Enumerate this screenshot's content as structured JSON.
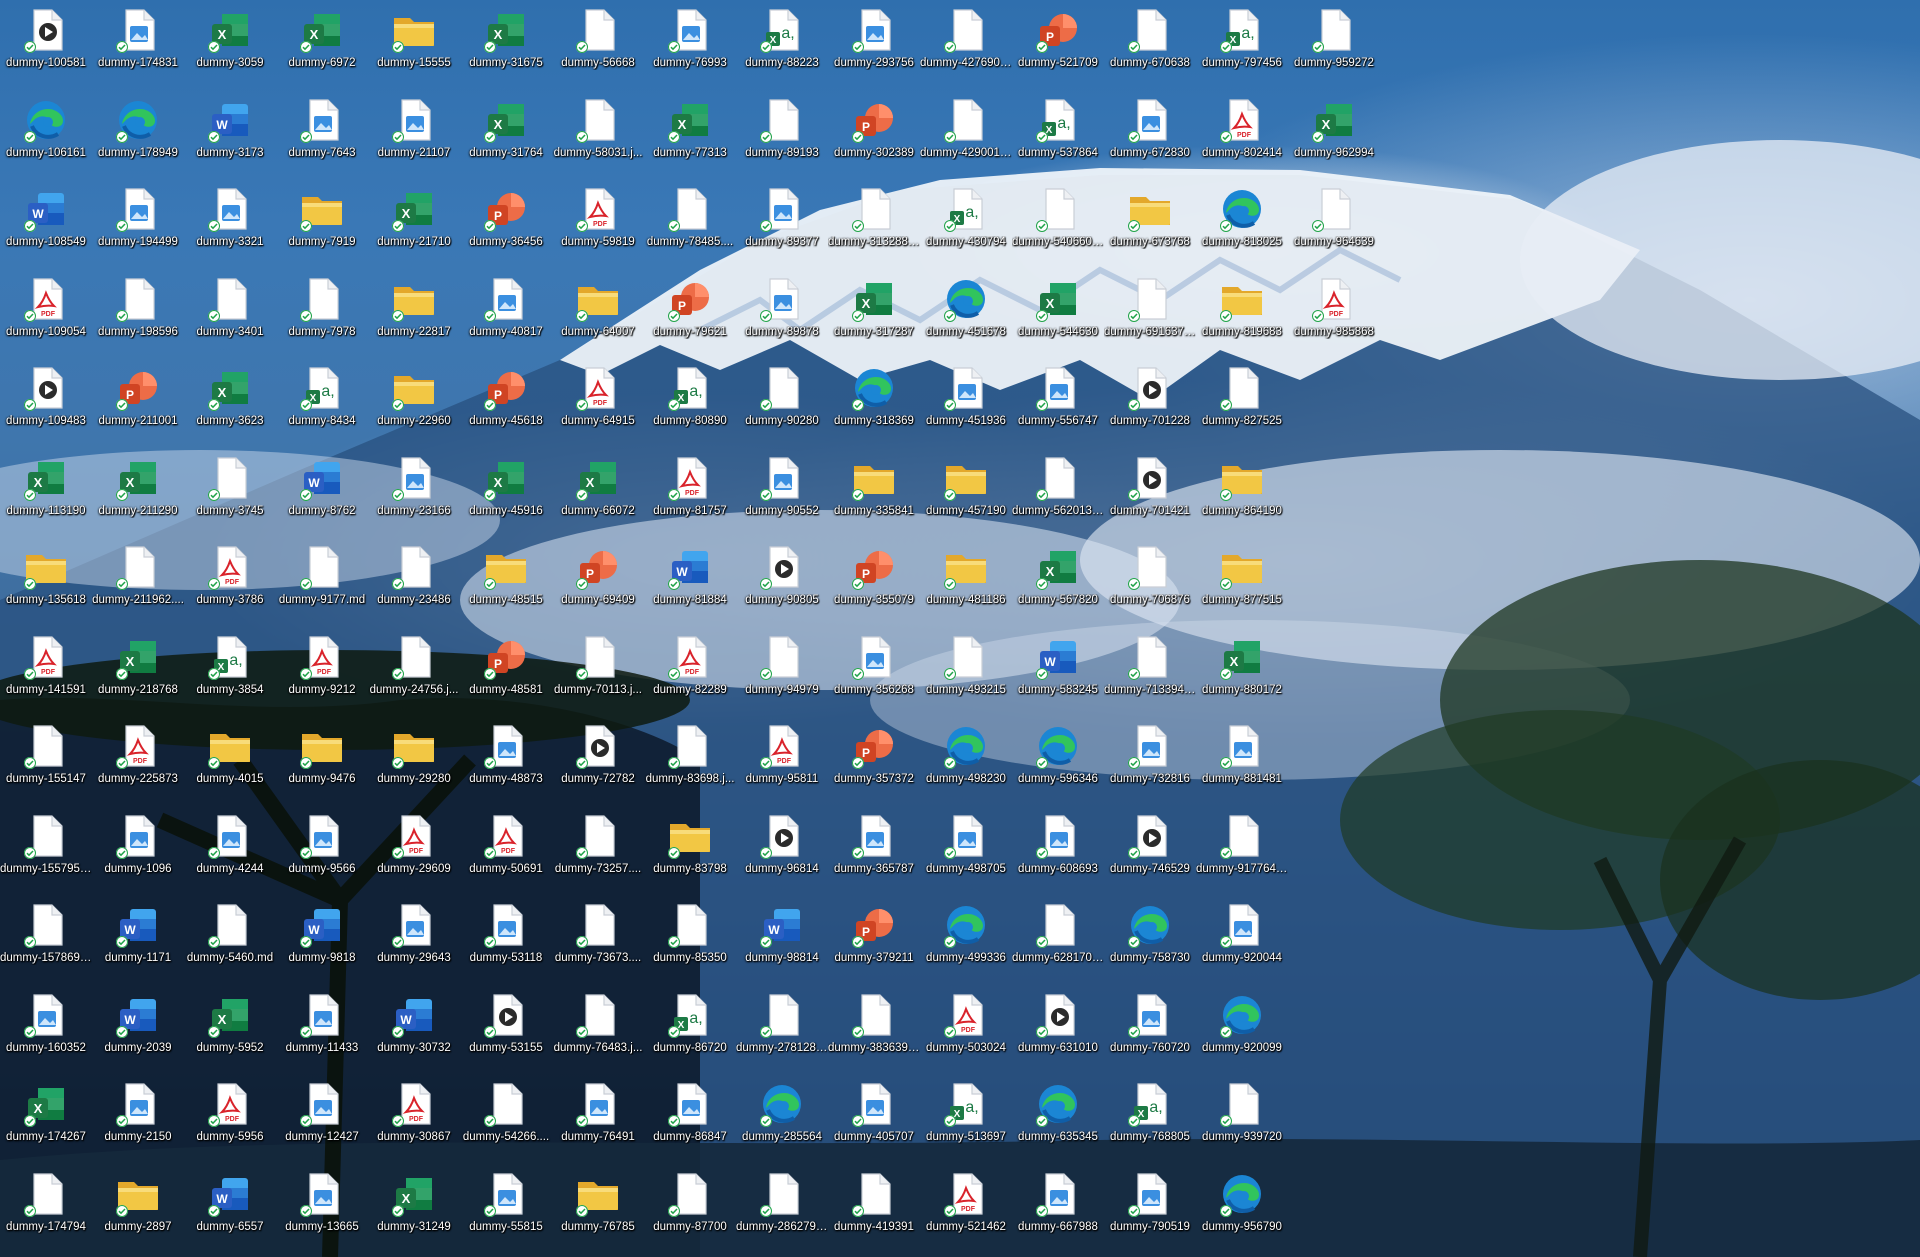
{
  "desktop": {
    "columns": [
      [
        {
          "label": "dummy-100581",
          "type": "video"
        },
        {
          "label": "dummy-106161",
          "type": "edge"
        },
        {
          "label": "dummy-108549",
          "type": "word"
        },
        {
          "label": "dummy-109054",
          "type": "pdf"
        },
        {
          "label": "dummy-109483",
          "type": "video"
        },
        {
          "label": "dummy-113190",
          "type": "excel"
        },
        {
          "label": "dummy-135618",
          "type": "folder"
        },
        {
          "label": "dummy-141591",
          "type": "pdf"
        },
        {
          "label": "dummy-155147",
          "type": "file"
        },
        {
          "label": "dummy-155795....",
          "type": "file"
        },
        {
          "label": "dummy-157869....",
          "type": "file"
        },
        {
          "label": "dummy-160352",
          "type": "image"
        },
        {
          "label": "dummy-174267",
          "type": "excel"
        },
        {
          "label": "dummy-174794",
          "type": "file"
        }
      ],
      [
        {
          "label": "dummy-174831",
          "type": "image"
        },
        {
          "label": "dummy-178949",
          "type": "edge"
        },
        {
          "label": "dummy-194499",
          "type": "image"
        },
        {
          "label": "dummy-198596",
          "type": "file"
        },
        {
          "label": "dummy-211001",
          "type": "ppt"
        },
        {
          "label": "dummy-211290",
          "type": "excel"
        },
        {
          "label": "dummy-211962....",
          "type": "file"
        },
        {
          "label": "dummy-218768",
          "type": "excel"
        },
        {
          "label": "dummy-225873",
          "type": "pdf"
        },
        {
          "label": "dummy-1096",
          "type": "image"
        },
        {
          "label": "dummy-1171",
          "type": "word"
        },
        {
          "label": "dummy-2039",
          "type": "word"
        },
        {
          "label": "dummy-2150",
          "type": "image"
        },
        {
          "label": "dummy-2897",
          "type": "folder"
        }
      ],
      [
        {
          "label": "dummy-3059",
          "type": "excel"
        },
        {
          "label": "dummy-3173",
          "type": "word"
        },
        {
          "label": "dummy-3321",
          "type": "image"
        },
        {
          "label": "dummy-3401",
          "type": "file"
        },
        {
          "label": "dummy-3623",
          "type": "excel"
        },
        {
          "label": "dummy-3745",
          "type": "file"
        },
        {
          "label": "dummy-3786",
          "type": "pdf"
        },
        {
          "label": "dummy-3854",
          "type": "csv"
        },
        {
          "label": "dummy-4015",
          "type": "folder"
        },
        {
          "label": "dummy-4244",
          "type": "image"
        },
        {
          "label": "dummy-5460.md",
          "type": "file"
        },
        {
          "label": "dummy-5952",
          "type": "excel"
        },
        {
          "label": "dummy-5956",
          "type": "pdf"
        },
        {
          "label": "dummy-6557",
          "type": "word"
        }
      ],
      [
        {
          "label": "dummy-6972",
          "type": "excel"
        },
        {
          "label": "dummy-7643",
          "type": "image"
        },
        {
          "label": "dummy-7919",
          "type": "folder"
        },
        {
          "label": "dummy-7978",
          "type": "file"
        },
        {
          "label": "dummy-8434",
          "type": "csv"
        },
        {
          "label": "dummy-8762",
          "type": "word"
        },
        {
          "label": "dummy-9177.md",
          "type": "file"
        },
        {
          "label": "dummy-9212",
          "type": "pdf"
        },
        {
          "label": "dummy-9476",
          "type": "folder"
        },
        {
          "label": "dummy-9566",
          "type": "image"
        },
        {
          "label": "dummy-9818",
          "type": "word"
        },
        {
          "label": "dummy-11433",
          "type": "image"
        },
        {
          "label": "dummy-12427",
          "type": "image"
        },
        {
          "label": "dummy-13665",
          "type": "image"
        }
      ],
      [
        {
          "label": "dummy-15555",
          "type": "folder"
        },
        {
          "label": "dummy-21107",
          "type": "image"
        },
        {
          "label": "dummy-21710",
          "type": "excel"
        },
        {
          "label": "dummy-22817",
          "type": "folder"
        },
        {
          "label": "dummy-22960",
          "type": "folder"
        },
        {
          "label": "dummy-23166",
          "type": "image"
        },
        {
          "label": "dummy-23486",
          "type": "file"
        },
        {
          "label": "dummy-24756.j...",
          "type": "file"
        },
        {
          "label": "dummy-29280",
          "type": "folder"
        },
        {
          "label": "dummy-29609",
          "type": "pdf"
        },
        {
          "label": "dummy-29643",
          "type": "image"
        },
        {
          "label": "dummy-30732",
          "type": "word"
        },
        {
          "label": "dummy-30867",
          "type": "pdf"
        },
        {
          "label": "dummy-31249",
          "type": "excel"
        }
      ],
      [
        {
          "label": "dummy-31675",
          "type": "excel"
        },
        {
          "label": "dummy-31764",
          "type": "excel"
        },
        {
          "label": "dummy-36456",
          "type": "ppt"
        },
        {
          "label": "dummy-40817",
          "type": "image"
        },
        {
          "label": "dummy-45618",
          "type": "ppt"
        },
        {
          "label": "dummy-45916",
          "type": "excel"
        },
        {
          "label": "dummy-48515",
          "type": "folder"
        },
        {
          "label": "dummy-48581",
          "type": "ppt"
        },
        {
          "label": "dummy-48873",
          "type": "image"
        },
        {
          "label": "dummy-50691",
          "type": "pdf"
        },
        {
          "label": "dummy-53118",
          "type": "image"
        },
        {
          "label": "dummy-53155",
          "type": "video"
        },
        {
          "label": "dummy-54266....",
          "type": "file"
        },
        {
          "label": "dummy-55815",
          "type": "image"
        }
      ],
      [
        {
          "label": "dummy-56668",
          "type": "file"
        },
        {
          "label": "dummy-58031.j...",
          "type": "file"
        },
        {
          "label": "dummy-59819",
          "type": "pdf"
        },
        {
          "label": "dummy-64007",
          "type": "folder"
        },
        {
          "label": "dummy-64915",
          "type": "pdf"
        },
        {
          "label": "dummy-66072",
          "type": "excel"
        },
        {
          "label": "dummy-69409",
          "type": "ppt"
        },
        {
          "label": "dummy-70113.j...",
          "type": "file"
        },
        {
          "label": "dummy-72782",
          "type": "video"
        },
        {
          "label": "dummy-73257....",
          "type": "file"
        },
        {
          "label": "dummy-73673....",
          "type": "file"
        },
        {
          "label": "dummy-76483.j...",
          "type": "file"
        },
        {
          "label": "dummy-76491",
          "type": "image"
        },
        {
          "label": "dummy-76785",
          "type": "folder"
        }
      ],
      [
        {
          "label": "dummy-76993",
          "type": "image"
        },
        {
          "label": "dummy-77313",
          "type": "excel"
        },
        {
          "label": "dummy-78485....",
          "type": "file"
        },
        {
          "label": "dummy-79621",
          "type": "ppt"
        },
        {
          "label": "dummy-80890",
          "type": "csv"
        },
        {
          "label": "dummy-81757",
          "type": "pdf"
        },
        {
          "label": "dummy-81884",
          "type": "word"
        },
        {
          "label": "dummy-82289",
          "type": "pdf"
        },
        {
          "label": "dummy-83698.j...",
          "type": "file"
        },
        {
          "label": "dummy-83798",
          "type": "folder"
        },
        {
          "label": "dummy-85350",
          "type": "file"
        },
        {
          "label": "dummy-86720",
          "type": "csv"
        },
        {
          "label": "dummy-86847",
          "type": "image"
        },
        {
          "label": "dummy-87700",
          "type": "file"
        }
      ],
      [
        {
          "label": "dummy-88223",
          "type": "csv"
        },
        {
          "label": "dummy-89193",
          "type": "file"
        },
        {
          "label": "dummy-89377",
          "type": "image"
        },
        {
          "label": "dummy-89878",
          "type": "image"
        },
        {
          "label": "dummy-90280",
          "type": "file"
        },
        {
          "label": "dummy-90552",
          "type": "image"
        },
        {
          "label": "dummy-90805",
          "type": "video"
        },
        {
          "label": "dummy-94979",
          "type": "file"
        },
        {
          "label": "dummy-95811",
          "type": "pdf"
        },
        {
          "label": "dummy-96814",
          "type": "video"
        },
        {
          "label": "dummy-98814",
          "type": "word"
        },
        {
          "label": "dummy-278128....",
          "type": "file"
        },
        {
          "label": "dummy-285564",
          "type": "edge"
        },
        {
          "label": "dummy-286279....",
          "type": "file"
        }
      ],
      [
        {
          "label": "dummy-293756",
          "type": "image"
        },
        {
          "label": "dummy-302389",
          "type": "ppt"
        },
        {
          "label": "dummy-313288....",
          "type": "file"
        },
        {
          "label": "dummy-317287",
          "type": "excel"
        },
        {
          "label": "dummy-318369",
          "type": "edge"
        },
        {
          "label": "dummy-335841",
          "type": "folder"
        },
        {
          "label": "dummy-355079",
          "type": "ppt"
        },
        {
          "label": "dummy-356268",
          "type": "image"
        },
        {
          "label": "dummy-357372",
          "type": "ppt"
        },
        {
          "label": "dummy-365787",
          "type": "image"
        },
        {
          "label": "dummy-379211",
          "type": "ppt"
        },
        {
          "label": "dummy-383639....",
          "type": "file"
        },
        {
          "label": "dummy-405707",
          "type": "image"
        },
        {
          "label": "dummy-419391",
          "type": "file"
        }
      ],
      [
        {
          "label": "dummy-427690....",
          "type": "file"
        },
        {
          "label": "dummy-429001....",
          "type": "file"
        },
        {
          "label": "dummy-430794",
          "type": "csv"
        },
        {
          "label": "dummy-451678",
          "type": "edge"
        },
        {
          "label": "dummy-451936",
          "type": "image"
        },
        {
          "label": "dummy-457190",
          "type": "folder"
        },
        {
          "label": "dummy-481186",
          "type": "folder"
        },
        {
          "label": "dummy-493215",
          "type": "file"
        },
        {
          "label": "dummy-498230",
          "type": "edge"
        },
        {
          "label": "dummy-498705",
          "type": "image"
        },
        {
          "label": "dummy-499336",
          "type": "edge"
        },
        {
          "label": "dummy-503024",
          "type": "pdf"
        },
        {
          "label": "dummy-513697",
          "type": "csv"
        },
        {
          "label": "dummy-521462",
          "type": "pdf"
        }
      ],
      [
        {
          "label": "dummy-521709",
          "type": "ppt"
        },
        {
          "label": "dummy-537864",
          "type": "csv"
        },
        {
          "label": "dummy-540660....",
          "type": "file"
        },
        {
          "label": "dummy-544630",
          "type": "excel"
        },
        {
          "label": "dummy-556747",
          "type": "image"
        },
        {
          "label": "dummy-562013....",
          "type": "file"
        },
        {
          "label": "dummy-567820",
          "type": "excel"
        },
        {
          "label": "dummy-583245",
          "type": "word"
        },
        {
          "label": "dummy-596346",
          "type": "edge"
        },
        {
          "label": "dummy-608693",
          "type": "image"
        },
        {
          "label": "dummy-628170....",
          "type": "file"
        },
        {
          "label": "dummy-631010",
          "type": "video"
        },
        {
          "label": "dummy-635345",
          "type": "edge"
        },
        {
          "label": "dummy-667988",
          "type": "image"
        }
      ],
      [
        {
          "label": "dummy-670638",
          "type": "file"
        },
        {
          "label": "dummy-672830",
          "type": "image"
        },
        {
          "label": "dummy-673768",
          "type": "folder"
        },
        {
          "label": "dummy-691637....",
          "type": "file"
        },
        {
          "label": "dummy-701228",
          "type": "video"
        },
        {
          "label": "dummy-701421",
          "type": "video"
        },
        {
          "label": "dummy-706876",
          "type": "file"
        },
        {
          "label": "dummy-713394....",
          "type": "file"
        },
        {
          "label": "dummy-732816",
          "type": "image"
        },
        {
          "label": "dummy-746529",
          "type": "video"
        },
        {
          "label": "dummy-758730",
          "type": "edge"
        },
        {
          "label": "dummy-760720",
          "type": "image"
        },
        {
          "label": "dummy-768805",
          "type": "csv"
        },
        {
          "label": "dummy-790519",
          "type": "image"
        }
      ],
      [
        {
          "label": "dummy-797456",
          "type": "csv"
        },
        {
          "label": "dummy-802414",
          "type": "pdf"
        },
        {
          "label": "dummy-818025",
          "type": "edge"
        },
        {
          "label": "dummy-819683",
          "type": "folder"
        },
        {
          "label": "dummy-827525",
          "type": "file"
        },
        {
          "label": "dummy-864190",
          "type": "folder"
        },
        {
          "label": "dummy-877515",
          "type": "folder"
        },
        {
          "label": "dummy-880172",
          "type": "excel"
        },
        {
          "label": "dummy-881481",
          "type": "image"
        },
        {
          "label": "dummy-917764....",
          "type": "file"
        },
        {
          "label": "dummy-920044",
          "type": "image"
        },
        {
          "label": "dummy-920099",
          "type": "edge"
        },
        {
          "label": "dummy-939720",
          "type": "file"
        },
        {
          "label": "dummy-956790",
          "type": "edge"
        }
      ],
      [
        {
          "label": "dummy-959272",
          "type": "file"
        },
        {
          "label": "dummy-962994",
          "type": "excel"
        },
        {
          "label": "dummy-964639",
          "type": "file"
        },
        {
          "label": "dummy-985868",
          "type": "pdf"
        }
      ]
    ]
  },
  "colors": {
    "excel": "#1d7a45",
    "word": "#2b5fc4",
    "ppt": "#d04423",
    "pdf": "#d9232b",
    "folder": "#f2c744",
    "image": "#3b8fe0",
    "sync_check": "#21a34a"
  }
}
